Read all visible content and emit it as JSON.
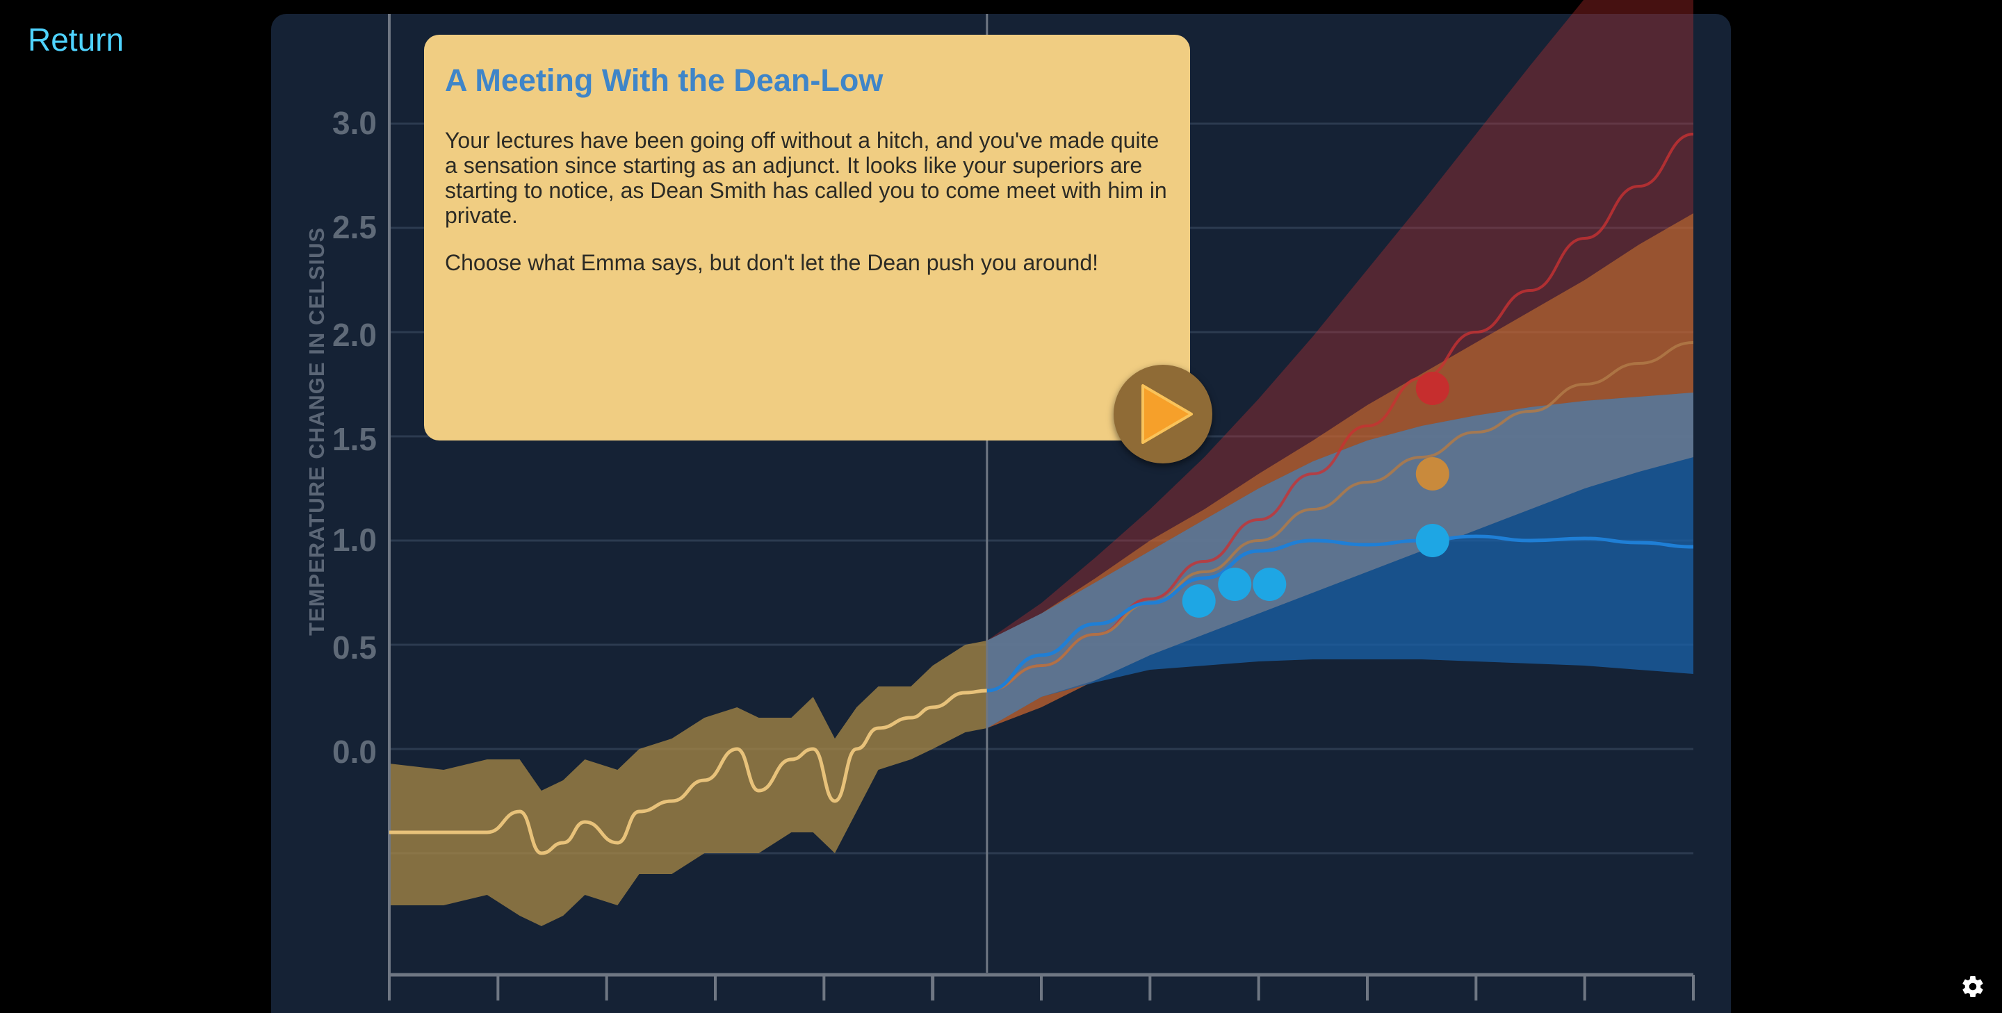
{
  "nav": {
    "return_label": "Return"
  },
  "dialog": {
    "title": "A Meeting With the Dean-Low",
    "paragraphs": [
      "Your lectures have been going off without a hitch, and you've made quite a sensation since starting as an adjunct. It looks like your superiors are starting to notice, as Dean Smith has called you to come meet with him in private.",
      "Choose what Emma says, but don't let the Dean push you around!"
    ],
    "play_icon": "play-icon"
  },
  "settings": {
    "icon": "gear-icon"
  },
  "colors": {
    "background": "#000000",
    "panel": "#152235",
    "dialog": "#f0cd82",
    "dialog_title": "#3f85c8",
    "return_link": "#4fd3ff",
    "historical": "#e8c27a",
    "high_scenario": "#c83232",
    "mid_scenario": "#d2782e",
    "low_scenario": "#1f7fd6",
    "marker": "#1ea6e4"
  },
  "chart_data": {
    "type": "line",
    "title": "",
    "xlabel": "",
    "ylabel": "TEMPERATURE CHANGE IN CELSIUS",
    "yticks": [
      "3.0",
      "2.5",
      "2.0",
      "1.5",
      "1.0",
      "0.5",
      "0.0"
    ],
    "ylim": [
      -1.1,
      3.5
    ],
    "x_segments": 12,
    "grid": true,
    "series": [
      {
        "key": "historical",
        "x": [
          0.0,
          0.5,
          0.9,
          1.2,
          1.4,
          1.6,
          1.8,
          2.1,
          2.3,
          2.6,
          2.9,
          3.2,
          3.4,
          3.7,
          3.9,
          4.1,
          4.3,
          4.5,
          4.8,
          5.0,
          5.3,
          5.5
        ],
        "y": [
          -0.4,
          -0.4,
          -0.4,
          -0.3,
          -0.5,
          -0.45,
          -0.35,
          -0.45,
          -0.3,
          -0.25,
          -0.15,
          0.0,
          -0.2,
          -0.05,
          0.0,
          -0.25,
          0.0,
          0.1,
          0.15,
          0.2,
          0.27,
          0.28
        ],
        "band_lower": [
          -0.75,
          -0.75,
          -0.7,
          -0.8,
          -0.85,
          -0.8,
          -0.7,
          -0.75,
          -0.6,
          -0.6,
          -0.5,
          -0.5,
          -0.5,
          -0.4,
          -0.4,
          -0.5,
          -0.3,
          -0.1,
          -0.05,
          0.0,
          0.08,
          0.1
        ],
        "band_upper": [
          -0.07,
          -0.1,
          -0.05,
          -0.05,
          -0.2,
          -0.15,
          -0.05,
          -0.1,
          0.0,
          0.05,
          0.15,
          0.2,
          0.15,
          0.15,
          0.25,
          0.05,
          0.2,
          0.3,
          0.3,
          0.4,
          0.5,
          0.52
        ]
      },
      {
        "key": "low",
        "x": [
          5.5,
          6.0,
          6.5,
          7.0,
          7.5,
          8.0,
          8.5,
          9.0,
          9.5,
          10.0,
          10.5,
          11.0,
          11.5,
          12.0
        ],
        "y": [
          0.28,
          0.45,
          0.6,
          0.7,
          0.82,
          0.95,
          1.0,
          0.98,
          1.0,
          1.02,
          1.0,
          1.01,
          0.99,
          0.97
        ],
        "band_lower": [
          0.1,
          0.25,
          0.32,
          0.38,
          0.4,
          0.42,
          0.43,
          0.43,
          0.43,
          0.42,
          0.41,
          0.4,
          0.38,
          0.36
        ],
        "band_upper": [
          0.52,
          0.65,
          0.8,
          0.95,
          1.1,
          1.25,
          1.38,
          1.48,
          1.55,
          1.6,
          1.64,
          1.67,
          1.69,
          1.71
        ]
      },
      {
        "key": "mid",
        "x": [
          5.5,
          6.0,
          6.5,
          7.0,
          7.5,
          8.0,
          8.5,
          9.0,
          9.5,
          10.0,
          10.5,
          11.0,
          11.5,
          12.0
        ],
        "y": [
          0.28,
          0.4,
          0.55,
          0.7,
          0.85,
          1.0,
          1.15,
          1.28,
          1.4,
          1.52,
          1.62,
          1.75,
          1.85,
          1.95
        ],
        "band_lower": [
          0.1,
          0.2,
          0.33,
          0.45,
          0.55,
          0.65,
          0.75,
          0.85,
          0.95,
          1.05,
          1.15,
          1.25,
          1.33,
          1.4
        ],
        "band_upper": [
          0.52,
          0.65,
          0.82,
          1.0,
          1.15,
          1.32,
          1.48,
          1.65,
          1.8,
          1.95,
          2.1,
          2.25,
          2.42,
          2.57
        ]
      },
      {
        "key": "high",
        "x": [
          5.5,
          6.0,
          6.5,
          7.0,
          7.5,
          8.0,
          8.5,
          9.0,
          9.5,
          10.0,
          10.5,
          11.0,
          11.5,
          12.0
        ],
        "y": [
          0.28,
          0.4,
          0.55,
          0.72,
          0.9,
          1.1,
          1.32,
          1.55,
          1.78,
          2.0,
          2.2,
          2.45,
          2.7,
          2.95
        ],
        "band_lower": [
          0.1,
          0.2,
          0.33,
          0.45,
          0.55,
          0.65,
          0.75,
          0.85,
          0.95,
          1.05,
          1.15,
          1.25,
          1.33,
          1.4
        ],
        "band_upper": [
          0.52,
          0.7,
          0.92,
          1.15,
          1.4,
          1.68,
          1.98,
          2.3,
          2.62,
          2.95,
          3.28,
          3.6,
          3.9,
          4.2
        ]
      }
    ],
    "markers": [
      {
        "scenario": "low",
        "x": 7.45,
        "y": 0.71
      },
      {
        "scenario": "low",
        "x": 7.78,
        "y": 0.79
      },
      {
        "scenario": "low",
        "x": 8.1,
        "y": 0.79
      },
      {
        "scenario": "low",
        "x": 9.6,
        "y": 1.0
      },
      {
        "scenario": "mid",
        "x": 9.6,
        "y": 1.32
      },
      {
        "scenario": "high",
        "x": 9.6,
        "y": 1.73
      }
    ]
  }
}
